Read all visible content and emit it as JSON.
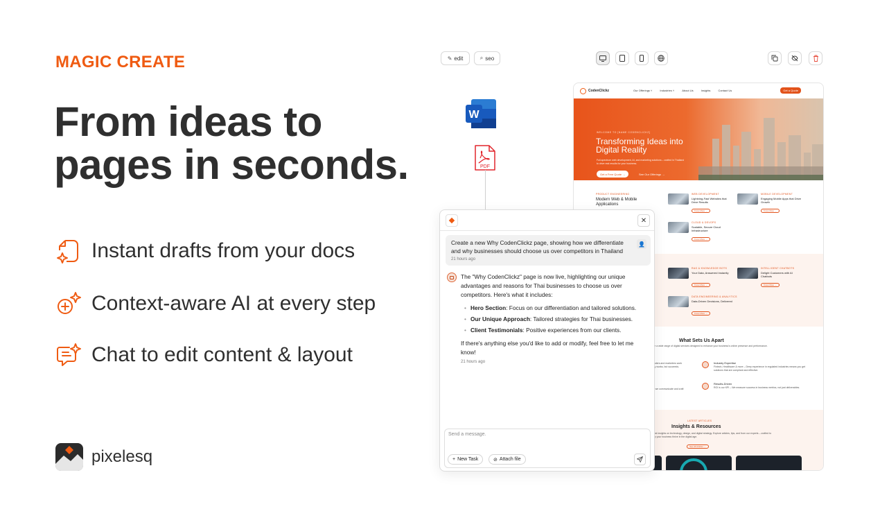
{
  "marketing": {
    "eyebrow": "MAGIC CREATE",
    "headline": "From ideas to pages in seconds.",
    "features": [
      "Instant drafts from your docs",
      "Context-aware AI at every step",
      "Chat to edit content & layout"
    ],
    "brand": "pixelesq",
    "accent_color": "#ef5b12"
  },
  "toolbar": {
    "edit_label": "edit",
    "seo_label": "seo",
    "icons": [
      "edit-icon",
      "seo-icon",
      "desktop-icon",
      "tablet-icon",
      "mobile-icon",
      "globe-icon",
      "copy-icon",
      "hide-icon",
      "delete-icon"
    ]
  },
  "docs": {
    "pdf_label": "PDF",
    "word_letter": "W"
  },
  "preview": {
    "logo": "CodenClickz",
    "nav": [
      "Our Offerings ˅",
      "Industries ˅",
      "About Us",
      "Insights",
      "Contact Us"
    ],
    "nav_cta": "Get a Quote",
    "hero": {
      "kicker": "WELCOME TO [NAME CODENCLICKZ]",
      "title": "Transforming Ideas into Digital Reality",
      "subtitle": "Full-spectrum web development, AI, and marketing solutions – crafted in Thailand to drive real results for your business.",
      "btn_primary": "Get a Free Quote →",
      "btn_secondary": "See Our Offerings →"
    },
    "s1": {
      "eyebrow": "PRODUCT ENGINEERING",
      "title": "Modern Web & Mobile Applications",
      "cards": [
        {
          "eyebrow": "WEB DEVELOPMENT",
          "title": "Lightning-Fast Websites that Drive Results"
        },
        {
          "eyebrow": "MOBILE DEVELOPMENT",
          "title": "Engaging Mobile Apps that Drive Growth"
        },
        {
          "eyebrow": "CLOUD & DEVOPS",
          "title": "Scalable, Secure Cloud Infrastructure"
        }
      ]
    },
    "s2": {
      "cards": [
        {
          "eyebrow": "RAG & KNOWLEDGE BOTS",
          "title": "Your Data, Answered Instantly"
        },
        {
          "eyebrow": "INTELLIGENT CHATBOTS",
          "title": "Delight Customers with AI Chatbots"
        },
        {
          "eyebrow": "DATA ENGINEERING & ANALYTICS",
          "title": "Data-Driven Decisions, Delivered"
        }
      ]
    },
    "more_label": "Know More →",
    "s3": {
      "title": "What Sets Us Apart",
      "intro": "ge a wide range of digital services designed to enhance your business's online presence and performance.",
      "left_frag1": "t coders and marketers work\nonly works, but succeeds.",
      "left_frag2": "ch, we communicate and craft\nrs.",
      "items": [
        {
          "title": "Industry Expertise",
          "text": "Fintech, Healthcare & more – Deep experience in regulated industries means you get solutions that are compliant and effective."
        },
        {
          "title": "Results-Driven",
          "text": "ROI is our KPI – We measure success in business metrics, not just deliverables."
        }
      ]
    },
    "s4": {
      "eyebrow": "LATEST ARTICLES",
      "title": "Insights & Resources",
      "text": "latest insights on technology, design, and digital strategy. Explore articles, tips, and from our experts – crafted to help your business thrive in the digital age.",
      "btn": "See All Articles →"
    }
  },
  "chat": {
    "user_message": "Create a new Why CodenClickz page, showing how we differentiate and why businesses should choose us over competitors in Thailand",
    "user_time": "21 hours ago",
    "bot_intro": "The \"Why CodenClickz\" page is now live, highlighting our unique advantages and reasons for Thai businesses to choose us over competitors. Here's what it includes:",
    "bullets": [
      {
        "label": "Hero Section",
        "text": ": Focus on our differentiation and tailored solutions."
      },
      {
        "label": "Our Unique Approach",
        "text": ": Tailored strategies for Thai businesses."
      },
      {
        "label": "Client Testimonials",
        "text": ": Positive experiences from our clients."
      }
    ],
    "bot_outro": "If there's anything else you'd like to add or modify, feel free to let me know!",
    "bot_time": "21 hours ago",
    "input_placeholder": "Send a message.",
    "new_task_label": "New Task",
    "attach_label": "Attach file"
  }
}
